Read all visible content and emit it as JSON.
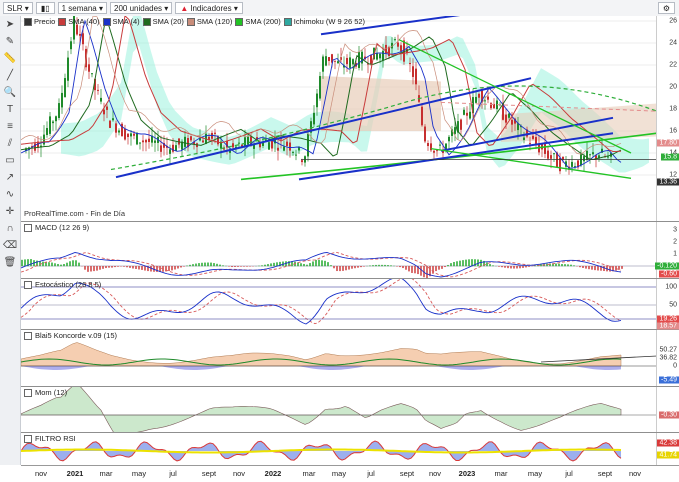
{
  "toolbar": {
    "ticker": "SLR",
    "period": "1 semana",
    "units": "200 unidades",
    "indicators_label": "Indicadores"
  },
  "main": {
    "legend": [
      "Precio",
      "SMA (40)",
      "SMA (4)",
      "SMA (20)",
      "SMA (120)",
      "SMA (200)",
      "Ichimoku (W 9 26 52)"
    ],
    "yticks": [
      "26",
      "24",
      "22",
      "20",
      "18",
      "16",
      "14",
      "12"
    ],
    "badges": [
      {
        "label": "17.80",
        "color": "#e38b8b"
      },
      {
        "label": "15.8",
        "color": "#2fae3a"
      },
      {
        "label": "13.36",
        "color": "#333333"
      }
    ],
    "watermark": "ProRealTime.com - Fin de Día"
  },
  "macd": {
    "title": "MACD (12 26 9)",
    "yticks": [
      "3",
      "2",
      "1",
      "0"
    ],
    "badges": [
      {
        "label": "-0.120",
        "color": "#2fae3a"
      },
      {
        "label": "-0.60",
        "color": "#e34b4b"
      }
    ]
  },
  "stoch": {
    "title": "Estocástico (26 8 5)",
    "yticks": [
      "100",
      "50"
    ],
    "badges": [
      {
        "label": "19.26",
        "color": "#e34b4b"
      },
      {
        "label": "18.57",
        "color": "#e38b8b"
      }
    ]
  },
  "blai5": {
    "title": "Blai5 Koncorde v.09 (15)",
    "yticks": [
      "50.27",
      "36.82",
      "0"
    ],
    "badges": [
      {
        "label": "-5.49",
        "color": "#3a6fd8"
      }
    ]
  },
  "mom": {
    "title": "Mom (12)",
    "yticks": [
      "0"
    ],
    "badges": [
      {
        "label": "-0.30",
        "color": "#d96c6c"
      }
    ]
  },
  "rsi": {
    "title": "FILTRO RSI",
    "yticks": [
      "42.38",
      "41.74"
    ],
    "badges": [
      {
        "label": "42.38",
        "color": "#d93a3a"
      },
      {
        "label": "41.74",
        "color": "#e7d400"
      }
    ]
  },
  "xaxis": [
    "nov",
    "2021",
    "mar",
    "may",
    "jul",
    "sept",
    "nov",
    "2022",
    "mar",
    "may",
    "jul",
    "sept",
    "nov",
    "2023",
    "mar",
    "may",
    "jul",
    "sept",
    "nov"
  ],
  "colors": {
    "up": "#1f8a2b",
    "down": "#c62f2f",
    "trend": "#1930c9",
    "sma200": "#22c324",
    "ichimoku_cloud": "#9cf2de",
    "ichimoku_red": "#c98d7a",
    "sma40": "#c83b3b"
  }
}
